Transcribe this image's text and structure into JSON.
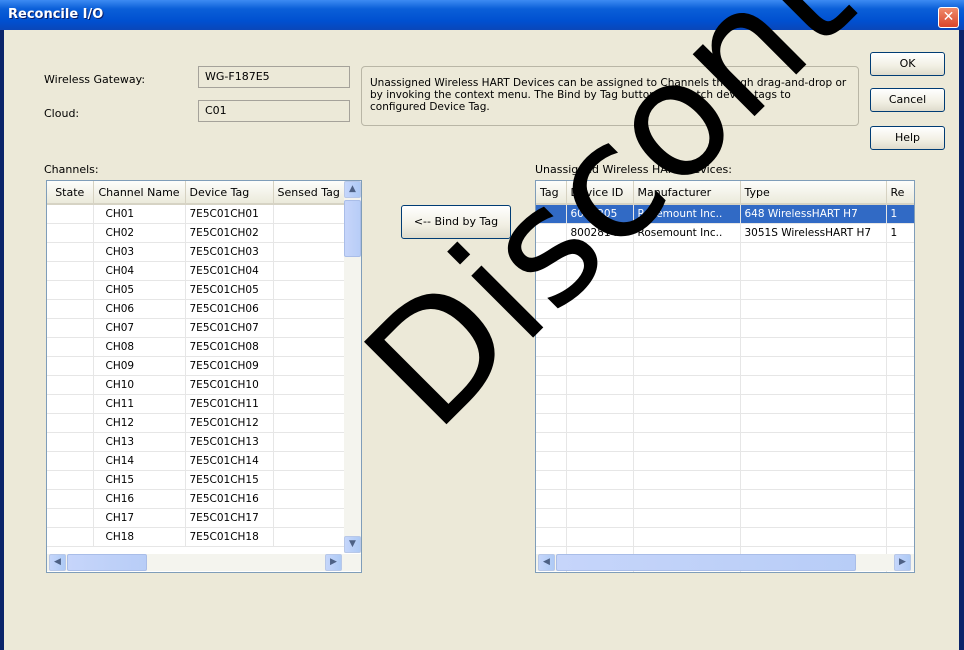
{
  "window": {
    "title": "Reconcile I/O",
    "close_label": "✕"
  },
  "gateway": {
    "label": "Wireless Gateway:",
    "value": "WG-F187E5"
  },
  "cloud": {
    "label": "Cloud:",
    "value": "C01"
  },
  "info_text": "Unassigned Wireless HART Devices can be assigned to Channels through drag-and-drop or by invoking the context menu. The Bind by Tag button will match device tags to configured Device Tag.",
  "buttons": {
    "ok": "OK",
    "cancel": "Cancel",
    "help": "Help",
    "bind": "<-- Bind by Tag"
  },
  "channels": {
    "label": "Channels:",
    "columns": [
      "State",
      "Channel Name",
      "Device Tag",
      "Sensed Tag"
    ],
    "rows": [
      {
        "state": "",
        "name": "CH01",
        "tag": "7E5C01CH01",
        "sensed": ""
      },
      {
        "state": "",
        "name": "CH02",
        "tag": "7E5C01CH02",
        "sensed": ""
      },
      {
        "state": "",
        "name": "CH03",
        "tag": "7E5C01CH03",
        "sensed": ""
      },
      {
        "state": "",
        "name": "CH04",
        "tag": "7E5C01CH04",
        "sensed": ""
      },
      {
        "state": "",
        "name": "CH05",
        "tag": "7E5C01CH05",
        "sensed": ""
      },
      {
        "state": "",
        "name": "CH06",
        "tag": "7E5C01CH06",
        "sensed": ""
      },
      {
        "state": "",
        "name": "CH07",
        "tag": "7E5C01CH07",
        "sensed": ""
      },
      {
        "state": "",
        "name": "CH08",
        "tag": "7E5C01CH08",
        "sensed": ""
      },
      {
        "state": "",
        "name": "CH09",
        "tag": "7E5C01CH09",
        "sensed": ""
      },
      {
        "state": "",
        "name": "CH10",
        "tag": "7E5C01CH10",
        "sensed": ""
      },
      {
        "state": "",
        "name": "CH11",
        "tag": "7E5C01CH11",
        "sensed": ""
      },
      {
        "state": "",
        "name": "CH12",
        "tag": "7E5C01CH12",
        "sensed": ""
      },
      {
        "state": "",
        "name": "CH13",
        "tag": "7E5C01CH13",
        "sensed": ""
      },
      {
        "state": "",
        "name": "CH14",
        "tag": "7E5C01CH14",
        "sensed": ""
      },
      {
        "state": "",
        "name": "CH15",
        "tag": "7E5C01CH15",
        "sensed": ""
      },
      {
        "state": "",
        "name": "CH16",
        "tag": "7E5C01CH16",
        "sensed": ""
      },
      {
        "state": "",
        "name": "CH17",
        "tag": "7E5C01CH17",
        "sensed": ""
      },
      {
        "state": "",
        "name": "CH18",
        "tag": "7E5C01CH18",
        "sensed": ""
      }
    ]
  },
  "devices": {
    "label": "Unassigned Wireless HART Devices:",
    "columns": [
      "Tag",
      "Device ID",
      "Manufacturer",
      "Type",
      "Re"
    ],
    "rows": [
      {
        "tag": "",
        "id": "6000205",
        "mfr": "Rosemount Inc..",
        "type": "648 WirelessHART H7",
        "re": "1",
        "selected": true
      },
      {
        "tag": "",
        "id": "8002814",
        "mfr": "Rosemount Inc..",
        "type": "3051S WirelessHART H7",
        "re": "1",
        "selected": false
      }
    ]
  },
  "watermark": "Discontinued",
  "scroll_glyphs": {
    "up": "▲",
    "down": "▼",
    "left": "◀",
    "right": "▶"
  }
}
